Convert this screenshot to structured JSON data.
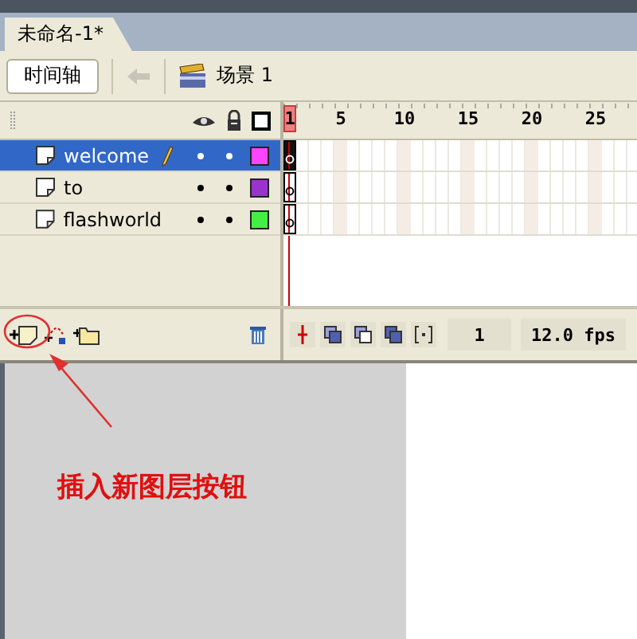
{
  "document_tab": {
    "title": "未命名-1*",
    "selected": true
  },
  "toolbar": {
    "timeline_button": "时间轴",
    "back_disabled": true,
    "scene": "场景 1"
  },
  "ruler": [
    {
      "label": "1",
      "current": true
    },
    {
      "label": "5",
      "current": false
    },
    {
      "label": "10",
      "current": false
    },
    {
      "label": "15",
      "current": false
    },
    {
      "label": "20",
      "current": false
    },
    {
      "label": "25",
      "current": false
    }
  ],
  "layers": [
    {
      "name": "welcome",
      "selected": true,
      "editing": true,
      "color": "#ff44ff"
    },
    {
      "name": "to",
      "selected": false,
      "editing": false,
      "color": "#9933cc"
    },
    {
      "name": "flashworld",
      "selected": false,
      "editing": false,
      "color": "#44ee44"
    }
  ],
  "status": {
    "current_frame": "1",
    "frame_rate": "12.0 fps"
  },
  "annotation": "插入新图层按钮"
}
